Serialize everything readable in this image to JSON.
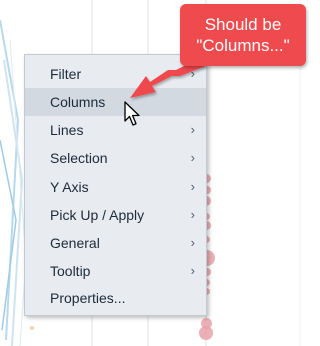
{
  "menu": {
    "items": [
      {
        "label": "Filter",
        "submenu": true,
        "highlighted": false
      },
      {
        "label": "Columns",
        "submenu": false,
        "highlighted": true
      },
      {
        "label": "Lines",
        "submenu": true,
        "highlighted": false
      },
      {
        "label": "Selection",
        "submenu": true,
        "highlighted": false
      },
      {
        "label": "Y Axis",
        "submenu": true,
        "highlighted": false
      },
      {
        "label": "Pick Up / Apply",
        "submenu": true,
        "highlighted": false
      },
      {
        "label": "General",
        "submenu": true,
        "highlighted": false
      },
      {
        "label": "Tooltip",
        "submenu": true,
        "highlighted": false
      },
      {
        "label": "Properties...",
        "submenu": false,
        "highlighted": false
      }
    ],
    "submenu_glyph": "›"
  },
  "annotation": {
    "line1": "Should be",
    "line2": "\"Columns...\""
  },
  "colors": {
    "callout": "#ef4a4d",
    "highlight": "#d2d9e1",
    "menu_bg": "#e8ecf0",
    "bubbles": "#e8a2a8"
  }
}
